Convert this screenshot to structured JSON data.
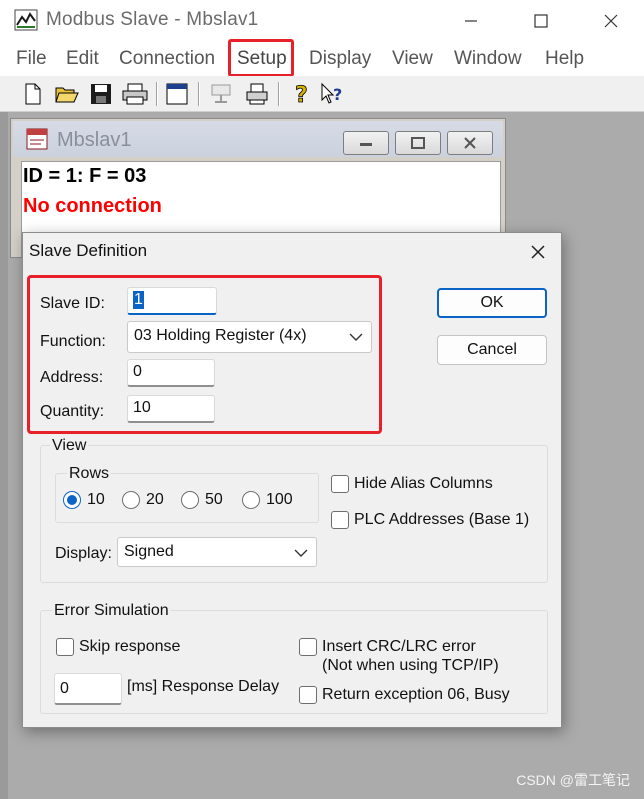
{
  "window": {
    "title": "Modbus Slave - Mbslav1",
    "menu": [
      "File",
      "Edit",
      "Connection",
      "Setup",
      "Display",
      "View",
      "Window",
      "Help"
    ]
  },
  "toolbar": {
    "icons": [
      "new-file-icon",
      "open-folder-icon",
      "save-icon",
      "print-icon",
      "window-icon",
      "connect-icon",
      "printer-device-icon",
      "help-icon",
      "context-help-icon"
    ]
  },
  "child": {
    "title": "Mbslav1",
    "id_line": "ID = 1: F = 03",
    "status": "No connection"
  },
  "dialog": {
    "title": "Slave Definition",
    "slave_id_label": "Slave ID:",
    "slave_id_value": "1",
    "function_label": "Function:",
    "function_value": "03 Holding Register (4x)",
    "address_label": "Address:",
    "address_value": "0",
    "quantity_label": "Quantity:",
    "quantity_value": "10",
    "ok_label": "OK",
    "cancel_label": "Cancel",
    "view_group": "View",
    "rows_group": "Rows",
    "rows_options": [
      "10",
      "20",
      "50",
      "100"
    ],
    "rows_selected": "10",
    "hide_alias_label": "Hide Alias Columns",
    "plc_addresses_label": "PLC Addresses (Base 1)",
    "display_label": "Display:",
    "display_value": "Signed",
    "error_group": "Error Simulation",
    "skip_response_label": "Skip response",
    "insert_crc_label": "Insert CRC/LRC error",
    "insert_crc_note": "(Not when using TCP/IP)",
    "delay_value": "0",
    "delay_label": "[ms] Response Delay",
    "return_exception_label": "Return exception 06, Busy"
  },
  "watermark": "CSDN @雷工笔记",
  "colors": {
    "highlight": "#e8202a",
    "accent": "#0a64c8",
    "error_text": "#ff0000"
  }
}
